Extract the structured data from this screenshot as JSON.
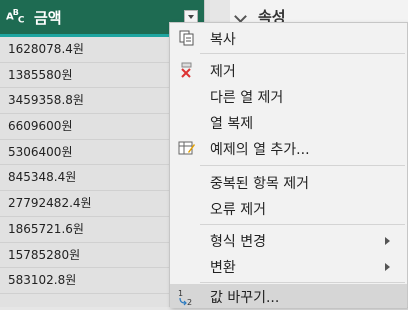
{
  "column": {
    "type_icon": "ABC",
    "type_sub": "C",
    "name": "금액",
    "cells": [
      "1628078.4원",
      "1385580원",
      "3459358.8원",
      "6609600원",
      "5306400원",
      "845348.4원",
      "27792482.4원",
      "1865721.6원",
      "15785280원",
      "583102.8원"
    ]
  },
  "panel": {
    "title": "속성"
  },
  "menu": {
    "items": [
      {
        "label": "복사",
        "icon": "copy-icon"
      },
      {
        "label": "제거",
        "icon": "remove-column-icon"
      },
      {
        "label": "다른 열 제거",
        "icon": ""
      },
      {
        "label": "열 복제",
        "icon": ""
      },
      {
        "label": "예제의 열 추가...",
        "icon": "column-from-examples-icon"
      },
      {
        "label": "중복된 항목 제거",
        "icon": ""
      },
      {
        "label": "오류 제거",
        "icon": ""
      },
      {
        "label": "형식 변경",
        "icon": "",
        "submenu": true
      },
      {
        "label": "변환",
        "icon": "",
        "submenu": true
      },
      {
        "label": "값 바꾸기...",
        "icon": "replace-values-icon"
      }
    ]
  },
  "colors": {
    "header": "#1e6b52",
    "accent": "#1ea5a0",
    "hover": "#d6d6d6"
  }
}
